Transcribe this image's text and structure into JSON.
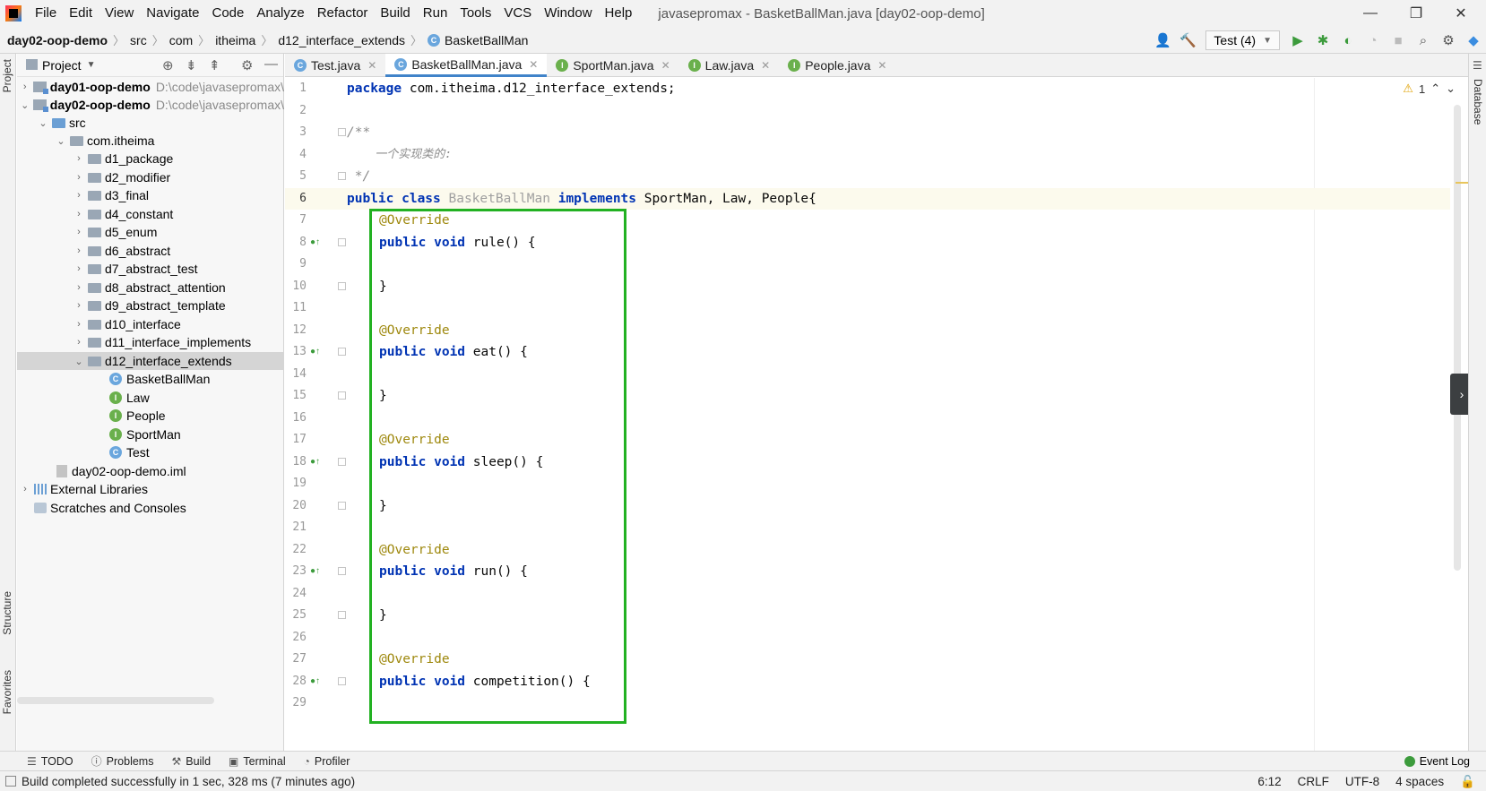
{
  "menubar": {
    "items": [
      "File",
      "Edit",
      "View",
      "Navigate",
      "Code",
      "Analyze",
      "Refactor",
      "Build",
      "Run",
      "Tools",
      "VCS",
      "Window",
      "Help"
    ],
    "window_title": "javasepromax - BasketBallMan.java [day02-oop-demo]",
    "minimize": "—",
    "restore": "❐",
    "close": "✕"
  },
  "breadcrumb": [
    "day02-oop-demo",
    "src",
    "com",
    "itheima",
    "d12_interface_extends",
    "BasketBallMan"
  ],
  "toolbar": {
    "run_config": "Test (4)",
    "icons": [
      "user-icon",
      "hammer-icon",
      "run-icon",
      "debug-icon",
      "coverage-icon",
      "profile-icon",
      "stop-icon",
      "search-icon",
      "gear-icon",
      "plugin-icon"
    ]
  },
  "left_strip": {
    "project": "Project",
    "structure": "Structure",
    "favorites": "Favorites"
  },
  "right_strip": {
    "database": "Database"
  },
  "project": {
    "title": "Project",
    "tree": [
      {
        "label": "day01-oop-demo",
        "path": "D:\\code\\javasepromax\\",
        "bold": true
      },
      {
        "label": "day02-oop-demo",
        "path": "D:\\code\\javasepromax\\",
        "bold": true
      },
      {
        "label": "src"
      },
      {
        "label": "com.itheima"
      },
      {
        "label": "d1_package"
      },
      {
        "label": "d2_modifier"
      },
      {
        "label": "d3_final"
      },
      {
        "label": "d4_constant"
      },
      {
        "label": "d5_enum"
      },
      {
        "label": "d6_abstract"
      },
      {
        "label": "d7_abstract_test"
      },
      {
        "label": "d8_abstract_attention"
      },
      {
        "label": "d9_abstract_template"
      },
      {
        "label": "d10_interface"
      },
      {
        "label": "d11_interface_implements"
      },
      {
        "label": "d12_interface_extends"
      },
      {
        "label": "BasketBallMan"
      },
      {
        "label": "Law"
      },
      {
        "label": "People"
      },
      {
        "label": "SportMan"
      },
      {
        "label": "Test"
      },
      {
        "label": "day02-oop-demo.iml"
      },
      {
        "label": "External Libraries"
      },
      {
        "label": "Scratches and Consoles"
      }
    ]
  },
  "tabs": [
    {
      "label": "Test.java",
      "kind": "C"
    },
    {
      "label": "BasketBallMan.java",
      "kind": "C"
    },
    {
      "label": "SportMan.java",
      "kind": "I"
    },
    {
      "label": "Law.java",
      "kind": "I"
    },
    {
      "label": "People.java",
      "kind": "I"
    }
  ],
  "editor": {
    "inspection_count": "1",
    "line_numbers": [
      "1",
      "2",
      "3",
      "4",
      "5",
      "6",
      "7",
      "8",
      "9",
      "10",
      "11",
      "12",
      "13",
      "14",
      "15",
      "16",
      "17",
      "18",
      "19",
      "20",
      "21",
      "22",
      "23",
      "24",
      "25",
      "26",
      "27",
      "28",
      "29"
    ],
    "code": {
      "l1_kw": "package",
      "l1_rest": " com.itheima.d12_interface_extends;",
      "l3": "/**",
      "l4": "    一个实现类的:",
      "l5": " */",
      "l6_kw": "public class",
      "l6_name": " BasketBallMan ",
      "l6_kw2": "implements",
      "l6_rest": " SportMan, Law, People{",
      "override": "@Override",
      "pv": "public void",
      "m_rule": " rule() {",
      "m_eat": " eat() {",
      "m_sleep": " sleep() {",
      "m_run": " run() {",
      "m_competition": " competition() {",
      "close": "}"
    }
  },
  "bottom_tools": [
    "TODO",
    "Problems",
    "Build",
    "Terminal",
    "Profiler"
  ],
  "event_log": "Event Log",
  "status": {
    "message": "Build completed successfully in 1 sec, 328 ms (7 minutes ago)",
    "position": "6:12",
    "line_sep": "CRLF",
    "encoding": "UTF-8",
    "indent": "4 spaces"
  }
}
